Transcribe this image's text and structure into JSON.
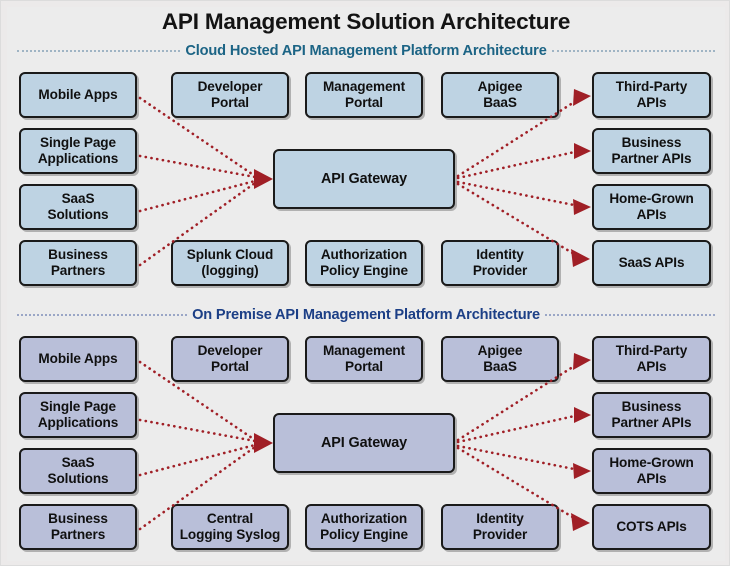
{
  "title": "API Management Solution Architecture",
  "colors": {
    "background": "#ececec",
    "cloud_box_fill": "#bed3e3",
    "onprem_box_fill": "#b9bfd9",
    "box_border": "#1a1a1a",
    "cloud_header_text": "#1c6485",
    "onprem_header_text": "#1c3f86",
    "arrow": "#a01f26",
    "title_text": "#141414"
  },
  "sections": [
    {
      "id": "cloud",
      "header": "Cloud Hosted API Management Platform Architecture",
      "consumers": [
        {
          "label": "Mobile Apps"
        },
        {
          "label": "Single Page\nApplications"
        },
        {
          "label": "SaaS\nSolutions"
        },
        {
          "label": "Business\nPartners"
        }
      ],
      "platform_top": [
        {
          "label": "Developer\nPortal"
        },
        {
          "label": "Management\nPortal"
        },
        {
          "label": "Apigee\nBaaS"
        }
      ],
      "gateway": {
        "label": "API Gateway"
      },
      "platform_bottom": [
        {
          "label": "Splunk Cloud\n(logging)"
        },
        {
          "label": "Authorization\nPolicy Engine"
        },
        {
          "label": "Identity\nProvider"
        }
      ],
      "backends": [
        {
          "label": "Third-Party\nAPIs"
        },
        {
          "label": "Business\nPartner APIs"
        },
        {
          "label": "Home-Grown\nAPIs"
        },
        {
          "label": "SaaS APIs"
        }
      ]
    },
    {
      "id": "onprem",
      "header": "On Premise API Management Platform Architecture",
      "consumers": [
        {
          "label": "Mobile Apps"
        },
        {
          "label": "Single Page\nApplications"
        },
        {
          "label": "SaaS\nSolutions"
        },
        {
          "label": "Business\nPartners"
        }
      ],
      "platform_top": [
        {
          "label": "Developer\nPortal"
        },
        {
          "label": "Management\nPortal"
        },
        {
          "label": "Apigee\nBaaS"
        }
      ],
      "gateway": {
        "label": "API Gateway"
      },
      "platform_bottom": [
        {
          "label": "Central\nLogging Syslog"
        },
        {
          "label": "Authorization\nPolicy Engine"
        },
        {
          "label": "Identity\nProvider"
        }
      ],
      "backends": [
        {
          "label": "Third-Party\nAPIs"
        },
        {
          "label": "Business\nPartner APIs"
        },
        {
          "label": "Home-Grown\nAPIs"
        },
        {
          "label": "COTS APIs"
        }
      ]
    }
  ]
}
